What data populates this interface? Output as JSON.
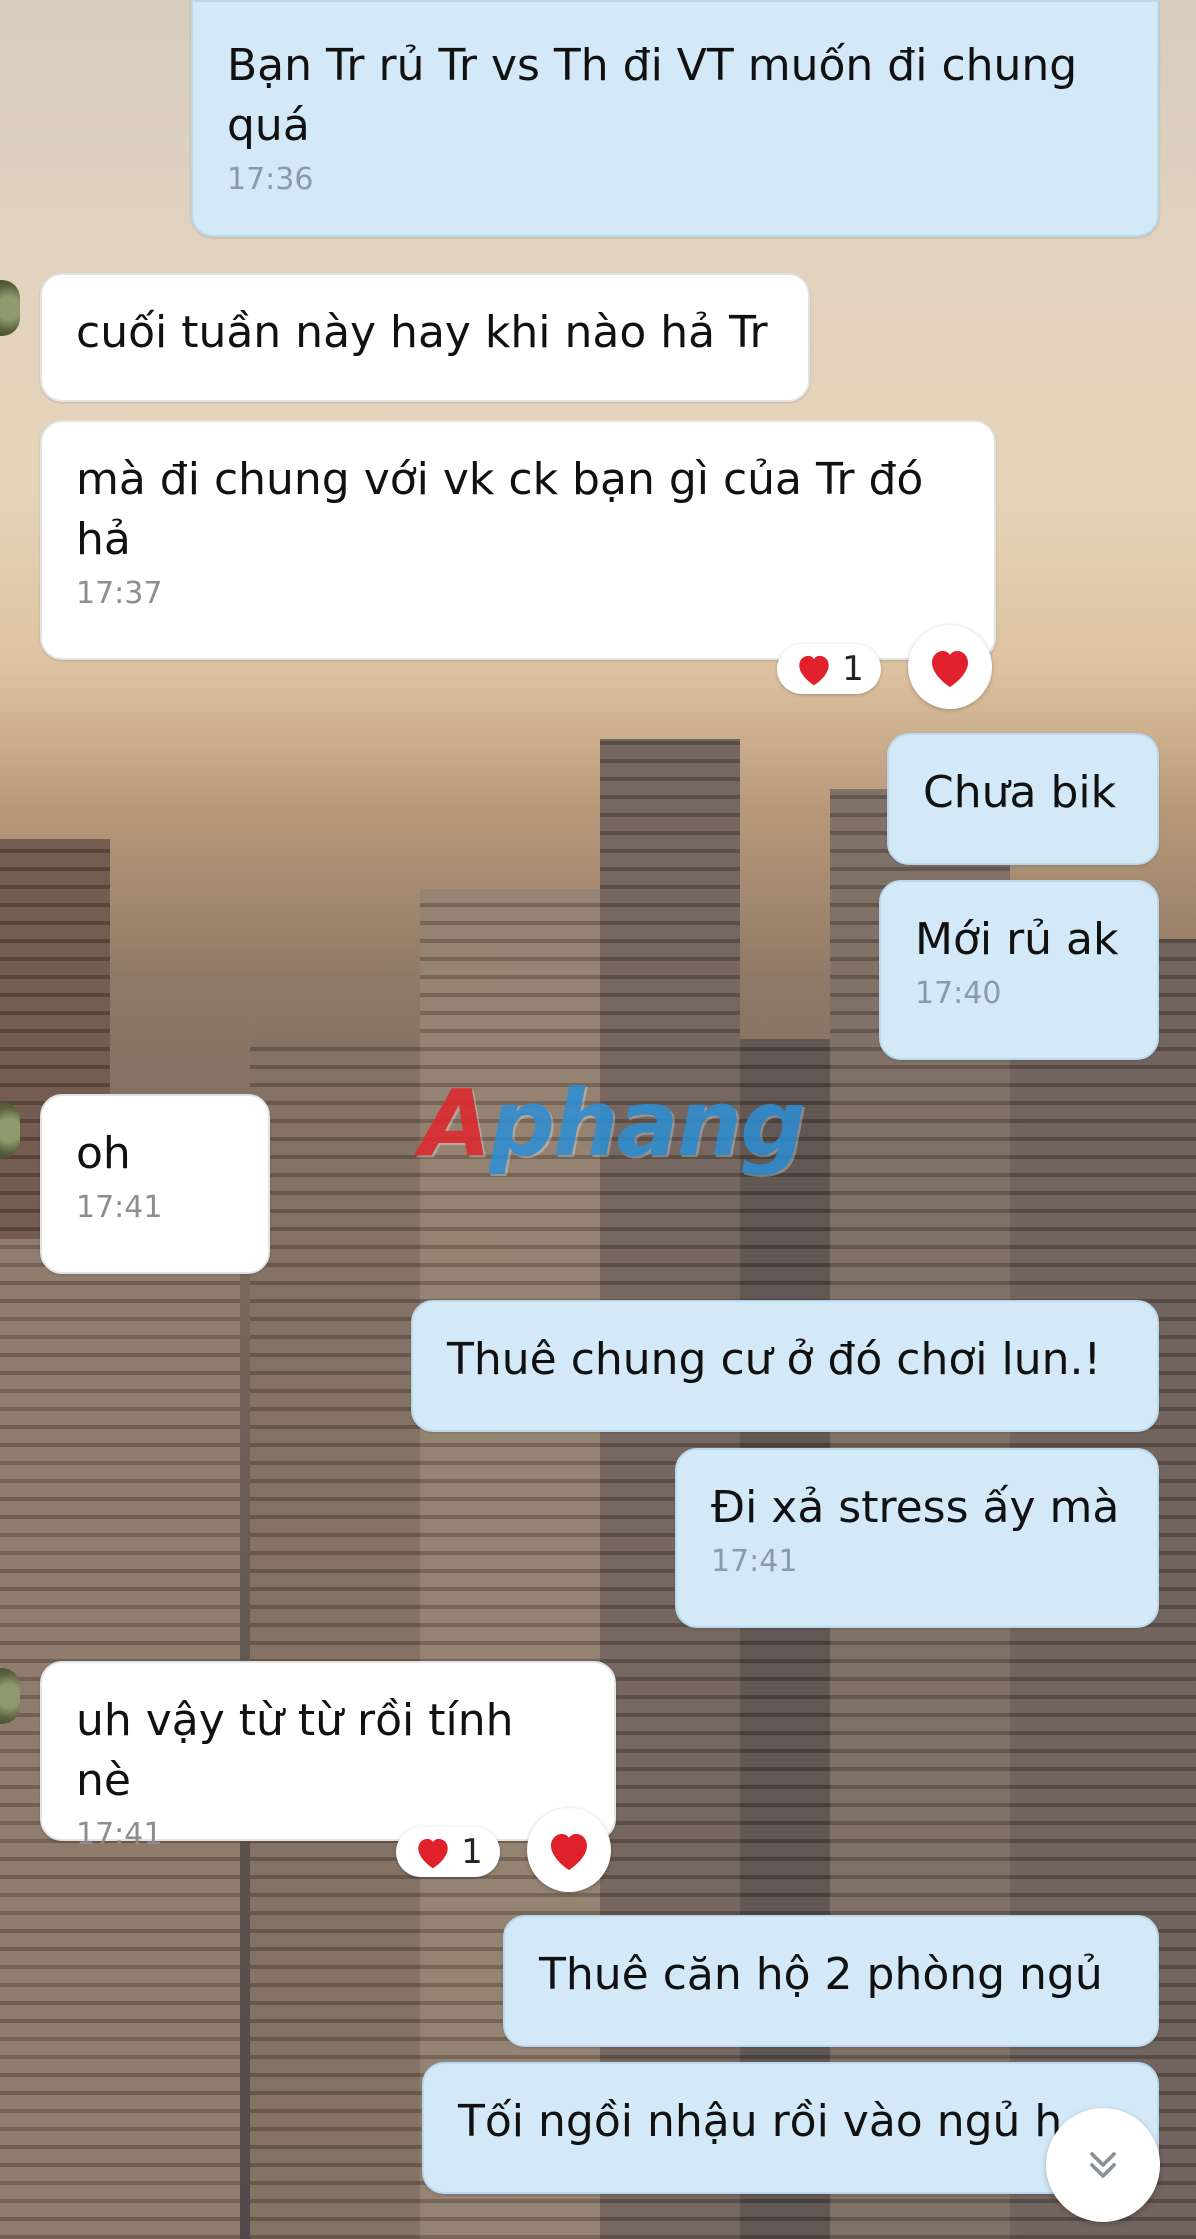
{
  "watermark": {
    "first": "A",
    "rest": "phang"
  },
  "messages": [
    {
      "dir": "out",
      "text": "Bạn Tr rủ Tr vs Th đi VT muốn đi chung quá",
      "time": "17:36"
    },
    {
      "dir": "in",
      "text": "cuối tuần này hay khi nào hả Tr",
      "time": ""
    },
    {
      "dir": "in",
      "text": "mà đi chung với vk ck bạn gì của Tr đó hả",
      "time": "17:37"
    },
    {
      "dir": "out",
      "text": "Chưa bik",
      "time": ""
    },
    {
      "dir": "out",
      "text": "Mới rủ ak",
      "time": "17:40"
    },
    {
      "dir": "in",
      "text": "oh",
      "time": "17:41"
    },
    {
      "dir": "out",
      "text": "Thuê chung cư ở đó chơi lun.!",
      "time": ""
    },
    {
      "dir": "out",
      "text": "Đi xả stress ấy mà",
      "time": "17:41"
    },
    {
      "dir": "in",
      "text": "uh vậy từ từ rồi tính nè",
      "time": "17:41"
    },
    {
      "dir": "out",
      "text": "Thuê căn hộ 2 phòng ngủ",
      "time": ""
    },
    {
      "dir": "out",
      "text": "Tối ngồi nhậu rồi vào ngủ h",
      "time": ""
    }
  ],
  "reactions": [
    {
      "emoji": "heart",
      "count": "1"
    },
    {
      "emoji": "heart",
      "count": "1"
    }
  ],
  "colors": {
    "outgoing": "#d3e9f8",
    "incoming": "#ffffff",
    "heart": "#e0202b"
  },
  "icons": {
    "scroll_down": "double-chevron-down-icon",
    "react": "heart-icon"
  }
}
